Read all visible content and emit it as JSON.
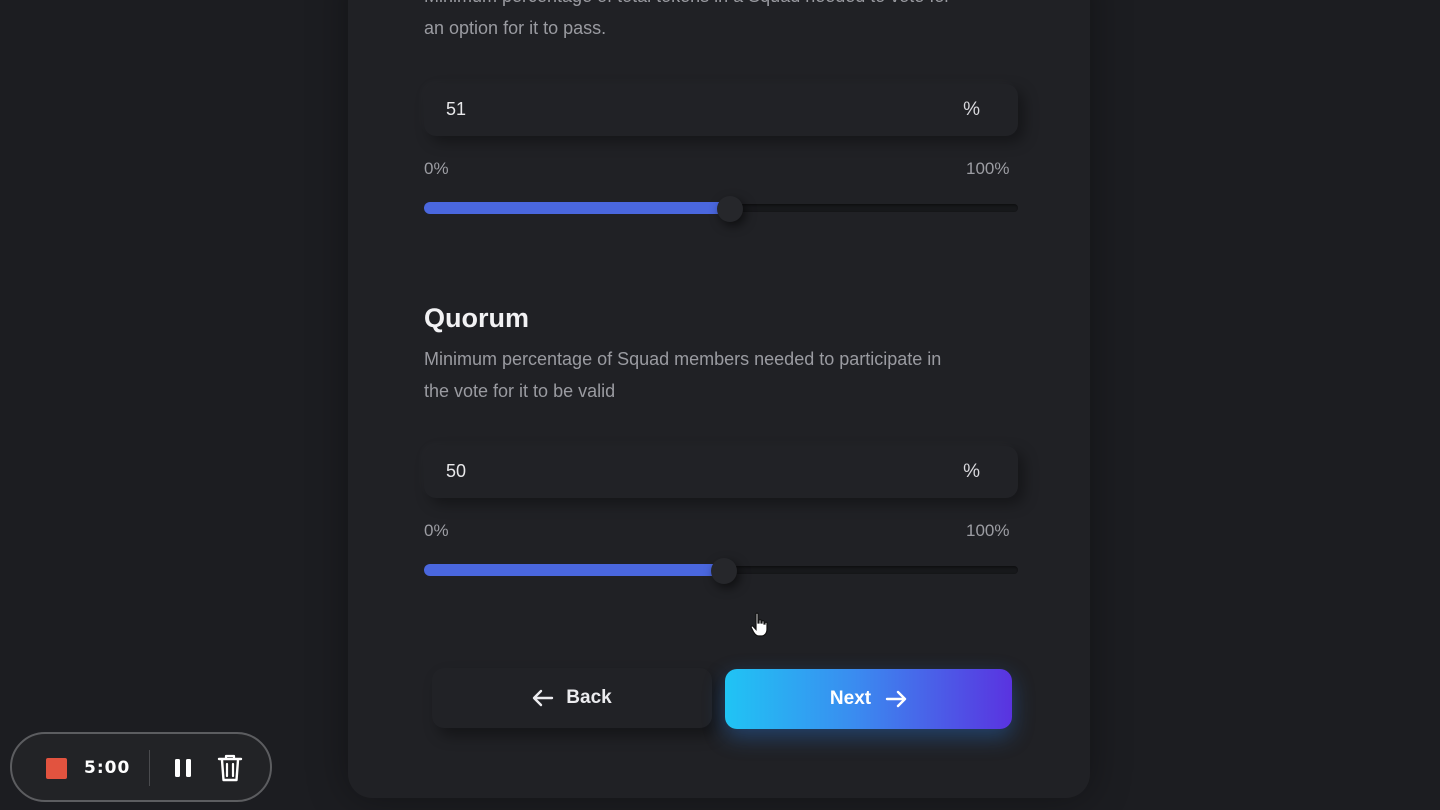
{
  "threshold": {
    "description": "Minimum percentage of total tokens in a Squad needed to vote for an option for it to pass.",
    "value": "51",
    "unit": "%",
    "min_label": "0%",
    "max_label": "100%",
    "level_percent": 51
  },
  "quorum": {
    "title": "Quorum",
    "description": "Minimum percentage of Squad members needed to participate in the vote for it to be valid",
    "value": "50",
    "unit": "%",
    "min_label": "0%",
    "max_label": "100%",
    "level_percent": 50
  },
  "footer": {
    "back_label": "Back",
    "next_label": "Next"
  },
  "recorder": {
    "time": "5:00"
  },
  "colors": {
    "slider_fill": "#4a67de",
    "next_gradient_start": "#20c4f4",
    "next_gradient_end": "#5a33e0",
    "record_stop": "#e2533f"
  },
  "icons": {
    "back": "arrow-left-icon",
    "next": "arrow-right-icon",
    "stop": "stop-icon",
    "pause": "pause-icon",
    "trash": "trash-icon",
    "cursor": "hand-pointer-icon"
  }
}
